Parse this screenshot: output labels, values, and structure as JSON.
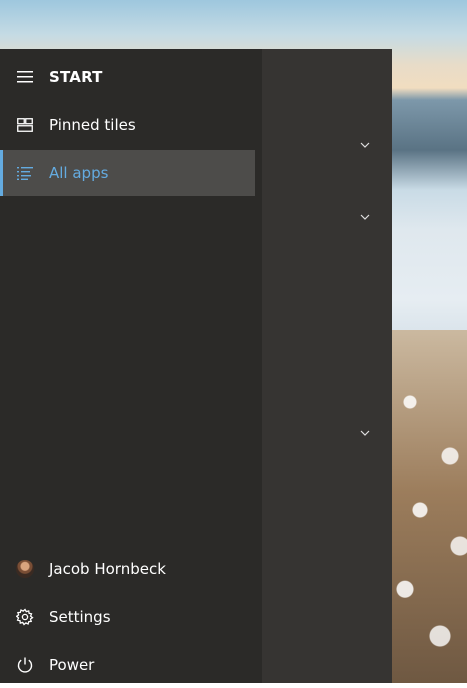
{
  "start_menu": {
    "header": "START",
    "nav_items": [
      {
        "label": "Pinned tiles",
        "icon": "tiles-icon"
      },
      {
        "label": "All apps",
        "icon": "list-icon"
      }
    ],
    "footer_items": [
      {
        "label": "Jacob Hornbeck",
        "icon": "avatar"
      },
      {
        "label": "Settings",
        "icon": "gear-icon"
      },
      {
        "label": "Power",
        "icon": "power-icon"
      }
    ],
    "accent_color": "#64abe0"
  }
}
